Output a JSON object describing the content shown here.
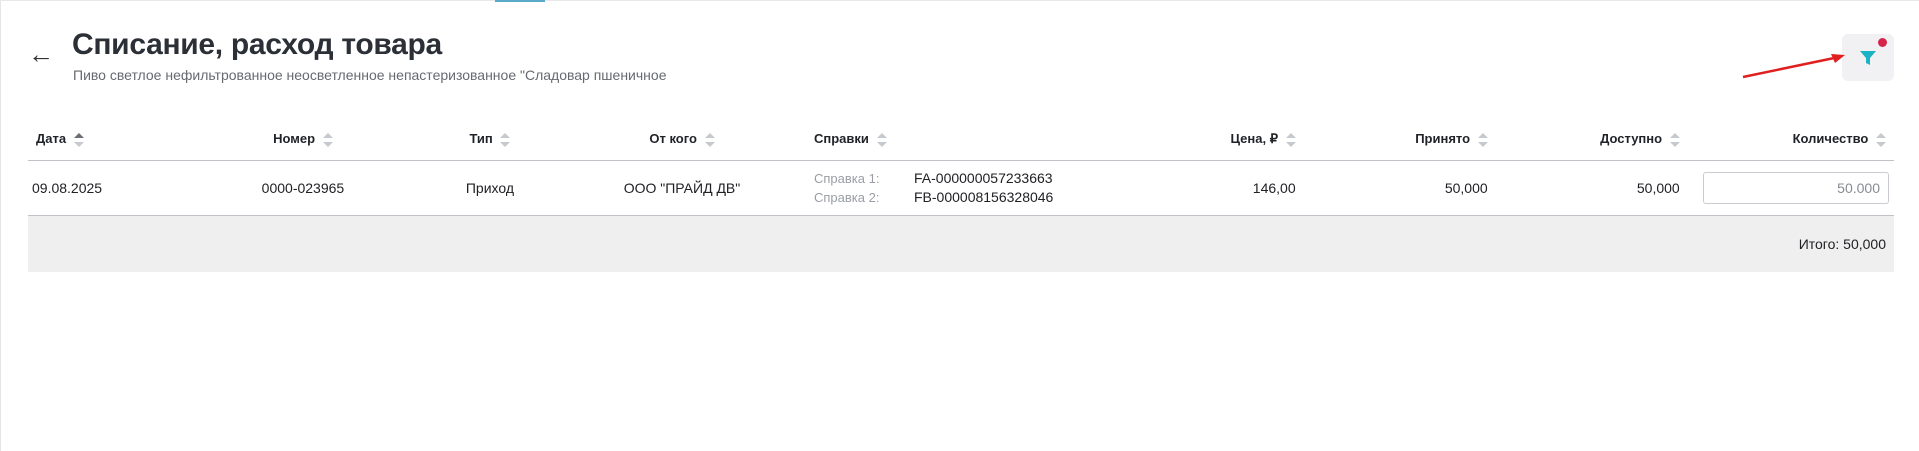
{
  "header": {
    "back_icon": "arrow-left-icon",
    "title": "Списание, расход товара",
    "subtitle": "Пиво светлое нефильтрованное неосветленное непастеризованное \"Сладовар пшеничное",
    "filter_icon": "filter-funnel-icon",
    "filter_active": true,
    "accent_color": "#1bb3c4",
    "badge_color": "#d6254a",
    "annotation_arrow_color": "#e02020"
  },
  "table": {
    "columns": [
      {
        "label": "Дата",
        "sorted": "asc"
      },
      {
        "label": "Номер"
      },
      {
        "label": "Тип"
      },
      {
        "label": "От кого"
      },
      {
        "label": "Справки"
      },
      {
        "label": "Цена, ₽"
      },
      {
        "label": "Принято"
      },
      {
        "label": "Доступно"
      },
      {
        "label": "Количество"
      }
    ],
    "rows": [
      {
        "date": "09.08.2025",
        "number": "0000-023965",
        "type": "Приход",
        "from": "ООО \"ПРАЙД ДВ\"",
        "refs": [
          {
            "label": "Справка 1:",
            "value": "FA-000000057233663"
          },
          {
            "label": "Справка 2:",
            "value": "FB-000008156328046"
          }
        ],
        "price": "146,00",
        "accepted": "50,000",
        "available": "50,000",
        "quantity": "50.000"
      }
    ],
    "total": "Итого: 50,000"
  }
}
